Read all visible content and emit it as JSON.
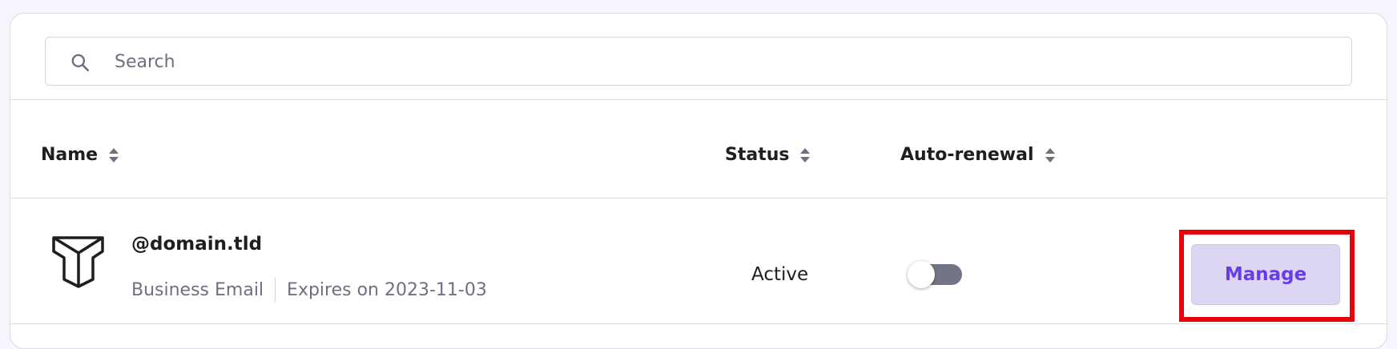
{
  "search": {
    "placeholder": "Search",
    "value": "",
    "icon": "search-icon"
  },
  "table": {
    "columns": [
      {
        "label": "Name",
        "sort_icon": "sort-icon"
      },
      {
        "label": "Status",
        "sort_icon": "sort-icon"
      },
      {
        "label": "Auto-renewal",
        "sort_icon": "sort-icon"
      }
    ],
    "rows": [
      {
        "logo_icon": "titan-logo-icon",
        "name": "@domain.tld",
        "product": "Business Email",
        "expires": "Expires on 2023-11-03",
        "status": "Active",
        "auto_renewal": false,
        "action_label": "Manage"
      }
    ]
  },
  "colors": {
    "accent": "#673de6",
    "button_bg": "#ddd6f2",
    "highlight": "#e8000b",
    "toggle_off": "#727586",
    "muted_text": "#6d7081"
  }
}
